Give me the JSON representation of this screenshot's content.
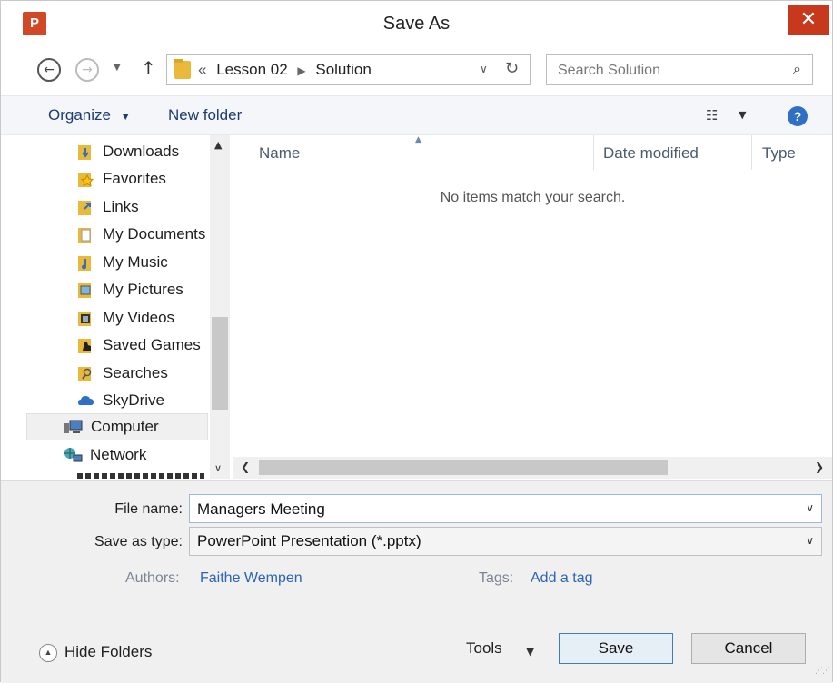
{
  "window": {
    "title": "Save As",
    "app_icon_letter": "P"
  },
  "address": {
    "crumbs": [
      "Lesson 02",
      "Solution"
    ],
    "overflow": "«"
  },
  "search": {
    "placeholder": "Search Solution"
  },
  "toolbar": {
    "organize": "Organize",
    "new_folder": "New folder"
  },
  "nav": {
    "items": [
      {
        "label": "Downloads",
        "icon": "downloads-folder-icon"
      },
      {
        "label": "Favorites",
        "icon": "favorites-folder-icon"
      },
      {
        "label": "Links",
        "icon": "links-folder-icon"
      },
      {
        "label": "My Documents",
        "icon": "documents-folder-icon"
      },
      {
        "label": "My Music",
        "icon": "music-folder-icon"
      },
      {
        "label": "My Pictures",
        "icon": "pictures-folder-icon"
      },
      {
        "label": "My Videos",
        "icon": "videos-folder-icon"
      },
      {
        "label": "Saved Games",
        "icon": "saved-games-folder-icon"
      },
      {
        "label": "Searches",
        "icon": "searches-folder-icon"
      },
      {
        "label": "SkyDrive",
        "icon": "skydrive-cloud-icon"
      },
      {
        "label": "Computer",
        "icon": "computer-icon"
      },
      {
        "label": "Network",
        "icon": "network-icon"
      }
    ]
  },
  "filelist": {
    "columns": [
      "Name",
      "Date modified",
      "Type"
    ],
    "empty_message": "No items match your search."
  },
  "form": {
    "file_name_label": "File name:",
    "file_name_value": "Managers Meeting",
    "save_type_label": "Save as type:",
    "save_type_value": "PowerPoint Presentation (*.pptx)",
    "authors_label": "Authors:",
    "authors_value": "Faithe Wempen",
    "tags_label": "Tags:",
    "tags_value": "Add a tag"
  },
  "footer": {
    "hide_folders": "Hide Folders",
    "tools": "Tools",
    "save": "Save",
    "cancel": "Cancel"
  },
  "colors": {
    "close": "#c7381d",
    "app_icon": "#d24726",
    "link": "#2c63b5",
    "toolbar_text": "#1e3c6e"
  }
}
